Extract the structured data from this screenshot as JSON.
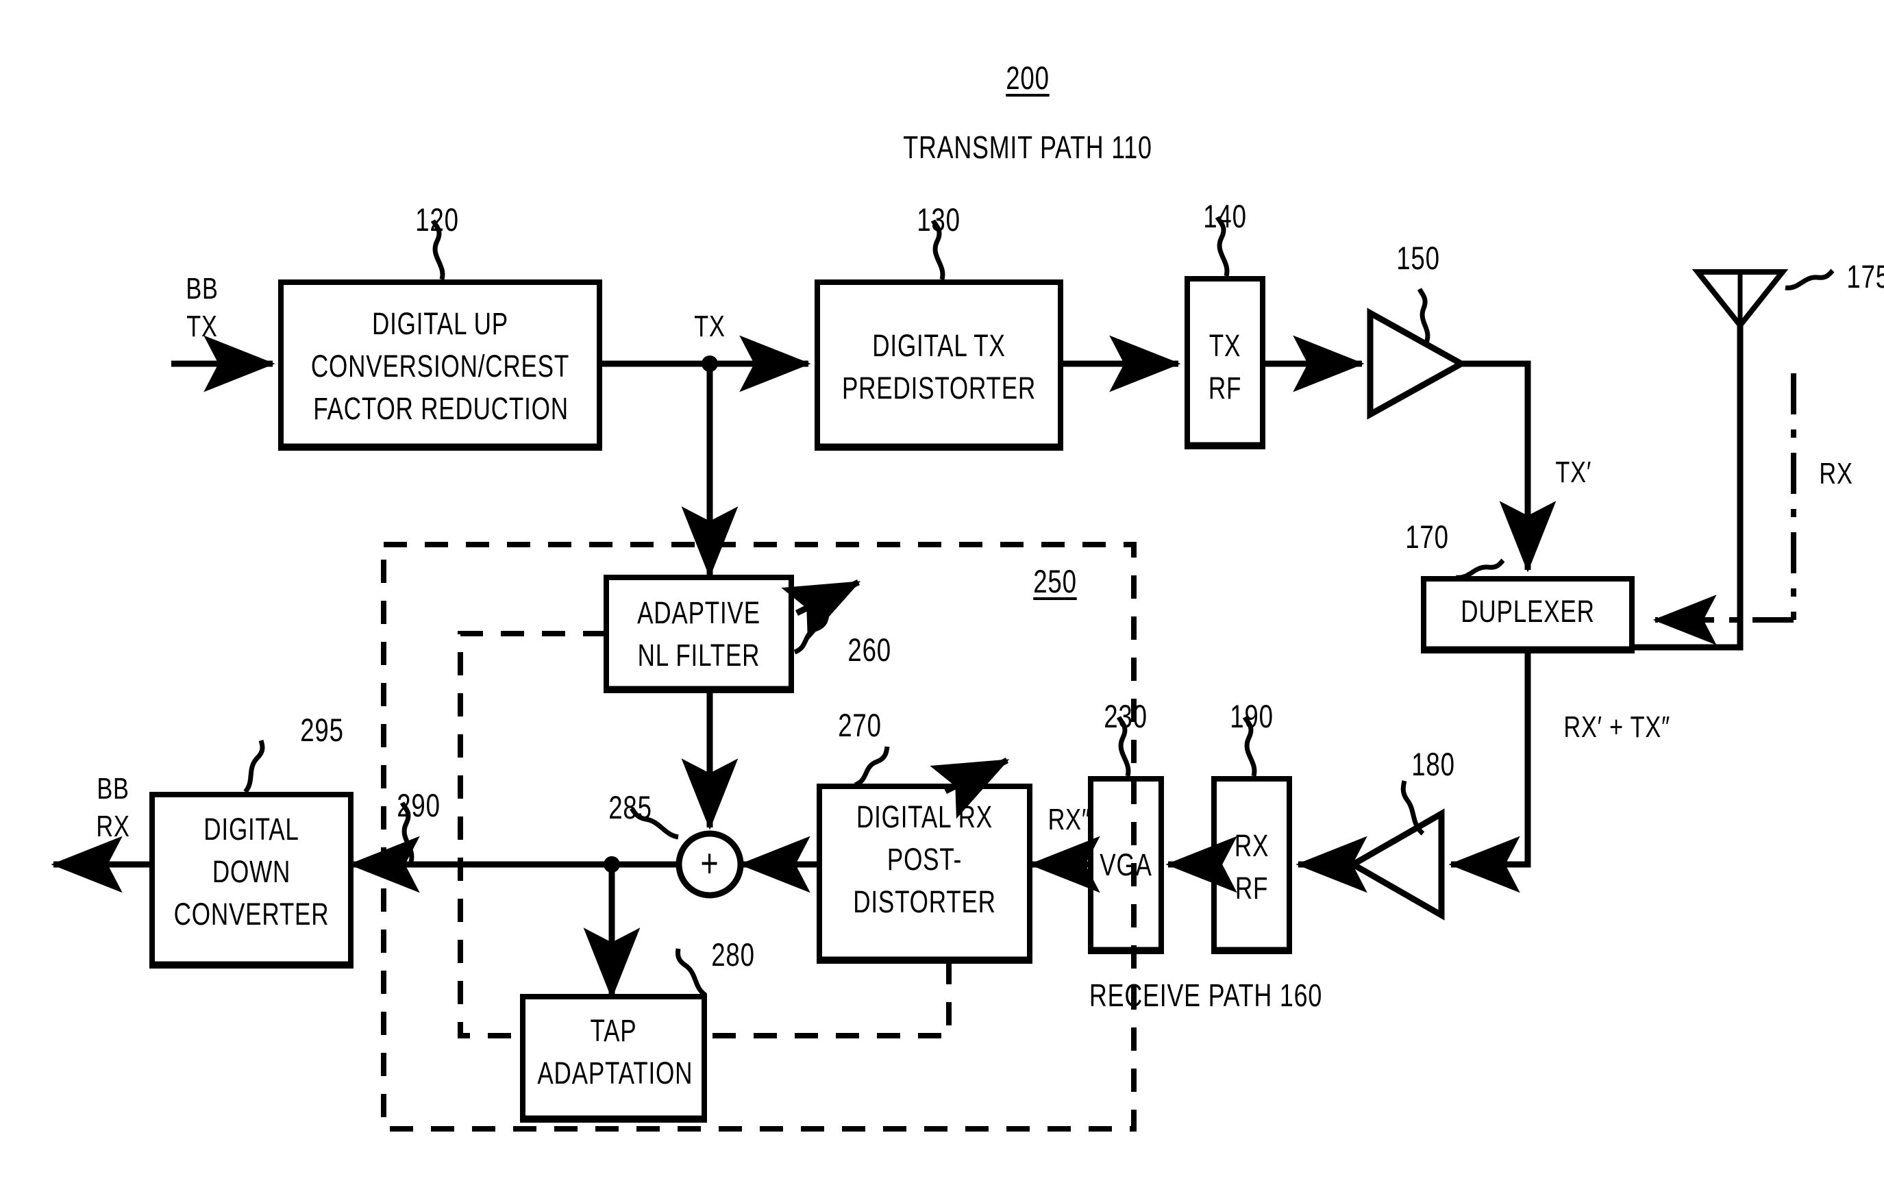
{
  "figure": {
    "number": "200",
    "transmit_path_label": "TRANSMIT PATH 110",
    "receive_path_label": "RECEIVE PATH 160",
    "cancellation_block_ref": "250"
  },
  "blocks": {
    "ducfr": {
      "ref": "120",
      "line1": "DIGITAL UP",
      "line2": "CONVERSION/CREST",
      "line3": "FACTOR REDUCTION"
    },
    "tx_predistorter": {
      "ref": "130",
      "line1": "DIGITAL TX",
      "line2": "PREDISTORTER"
    },
    "tx_rf": {
      "ref": "140",
      "line1": "TX",
      "line2": "RF"
    },
    "pa": {
      "ref": "150"
    },
    "antenna": {
      "ref": "175"
    },
    "duplexer": {
      "ref": "170",
      "label": "DUPLEXER"
    },
    "lna": {
      "ref": "180"
    },
    "rx_rf": {
      "ref": "190",
      "line1": "RX",
      "line2": "RF"
    },
    "vga": {
      "ref": "230",
      "label": "VGA"
    },
    "rx_postdistorter": {
      "ref": "270",
      "line1": "DIGITAL RX",
      "line2": "POST-",
      "line3": "DISTORTER"
    },
    "adaptive_nl_filter": {
      "ref": "260",
      "line1": "ADAPTIVE",
      "line2": "NL FILTER"
    },
    "tap_adaptation": {
      "ref": "280",
      "line1": "TAP",
      "line2": "ADAPTATION"
    },
    "summer": {
      "ref": "285",
      "symbol": "+"
    },
    "ddc": {
      "ref": "295",
      "line1": "DIGITAL",
      "line2": "DOWN",
      "line3": "CONVERTER"
    }
  },
  "signals": {
    "bb_tx": {
      "line1": "BB",
      "line2": "TX"
    },
    "bb_rx": {
      "line1": "BB",
      "line2": "RX"
    },
    "tx": "TX",
    "tx_prime": "TX′",
    "rx": "RX",
    "rx_prime_plus_tx_dprime": "RX′ + TX″",
    "rx_dprime": "RX″",
    "cancelled_out_ref": "290"
  },
  "colors": {
    "ink": "#000000",
    "paper": "#ffffff"
  }
}
